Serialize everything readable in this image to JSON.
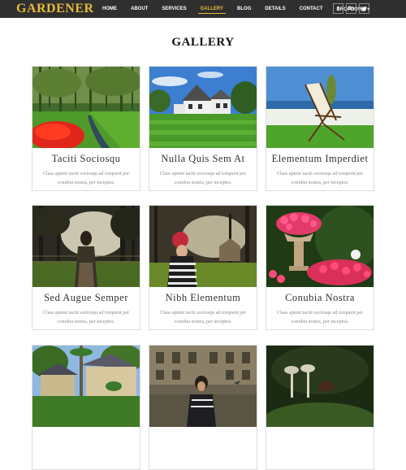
{
  "brand": "GARDENER",
  "nav": {
    "items": [
      {
        "label": "HOME"
      },
      {
        "label": "ABOUT"
      },
      {
        "label": "SERVICES"
      },
      {
        "label": "GALLERY"
      },
      {
        "label": "BLOG"
      },
      {
        "label": "DETAILS"
      },
      {
        "label": "CONTACT"
      },
      {
        "label": "DROPDOWN ▾"
      }
    ],
    "active_label": "GALLERY",
    "social": [
      {
        "label": "f",
        "icon": "facebook-icon"
      },
      {
        "label": "G+",
        "icon": "google-plus-icon"
      },
      {
        "label": "🐦",
        "icon": "twitter-icon"
      }
    ]
  },
  "page_title": "GALLERY",
  "gallery": [
    {
      "title": "Taciti Sociosqu",
      "desc": "Class aptent taciti sociosqu ad torquent per conubia nostra, per inceptos."
    },
    {
      "title": "Nulla Quis Sem At",
      "desc": "Class aptent taciti sociosqu ad torquent per conubia nostra, per inceptos."
    },
    {
      "title": "Elementum Imperdiet",
      "desc": "Class aptent taciti sociosqu ad torquent per conubia nostra, per inceptos."
    },
    {
      "title": "Sed Augue Semper",
      "desc": "Class aptent taciti sociosqu ad torquent per conubia nostra, per inceptos."
    },
    {
      "title": "Nibh Elementum",
      "desc": "Class aptent taciti sociosqu ad torquent per conubia nostra, per inceptos."
    },
    {
      "title": "Conubia Nostra",
      "desc": "Class aptent taciti sociosqu ad torquent per conubia nostra, per inceptos."
    },
    {
      "title": "",
      "desc": ""
    },
    {
      "title": "",
      "desc": ""
    },
    {
      "title": "",
      "desc": ""
    }
  ],
  "colors": {
    "navbar": "#2f2f2f",
    "accent": "#e8b93a"
  }
}
